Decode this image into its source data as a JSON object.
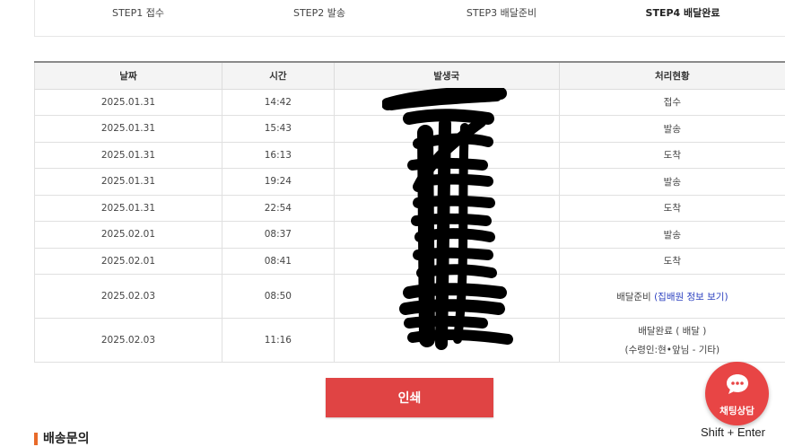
{
  "steps": [
    {
      "label": "STEP1 접수",
      "active": false
    },
    {
      "label": "STEP2 발송",
      "active": false
    },
    {
      "label": "STEP3 배달준비",
      "active": false
    },
    {
      "label": "STEP4 배달완료",
      "active": true
    }
  ],
  "table": {
    "headers": {
      "date": "날짜",
      "time": "시간",
      "office": "발생국",
      "status": "처리현황"
    },
    "rows": [
      {
        "date": "2025.01.31",
        "time": "14:42",
        "status": "접수"
      },
      {
        "date": "2025.01.31",
        "time": "15:43",
        "status": "발송"
      },
      {
        "date": "2025.01.31",
        "time": "16:13",
        "status": "도착"
      },
      {
        "date": "2025.01.31",
        "time": "19:24",
        "status": "발송"
      },
      {
        "date": "2025.01.31",
        "time": "22:54",
        "status": "도착"
      },
      {
        "date": "2025.02.01",
        "time": "08:37",
        "status": "발송"
      },
      {
        "date": "2025.02.01",
        "time": "08:41",
        "status": "도착"
      },
      {
        "date": "2025.02.03",
        "time": "08:50",
        "status": "배달준비",
        "status_link": "(집배원 정보 보기)"
      },
      {
        "date": "2025.02.03",
        "time": "11:16",
        "status": "배달완료 ( 배달 )",
        "status_sub": "(수령인:현•앞님 - 기타)"
      }
    ]
  },
  "print_button": "인쇄",
  "chat": {
    "label": "채팅상담",
    "shortcut": "Shift + Enter"
  },
  "section_heading": "배송문의",
  "colors": {
    "accent": "#e04444",
    "link": "#2a3fbf",
    "heading_bar": "#e86a2a"
  }
}
